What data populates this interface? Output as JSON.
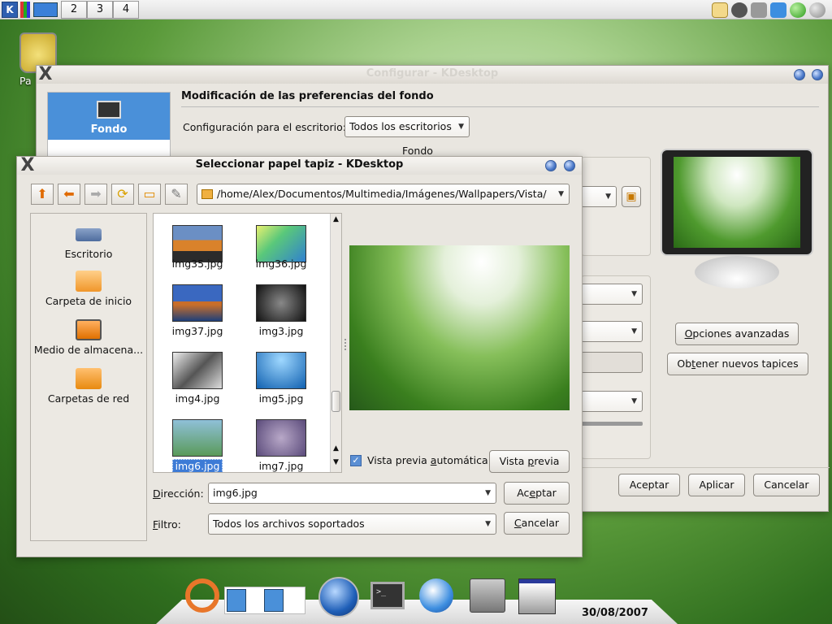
{
  "top_panel": {
    "pagers": [
      "2",
      "3",
      "4"
    ]
  },
  "desktop": {
    "trash_label": "Pa"
  },
  "config": {
    "title": "Configurar - KDesktop",
    "sidebar_active": "Fondo",
    "heading": "Modificación de las preferencias del fondo",
    "desktop_config_label": "Configuración para el escritorio:",
    "desktop_config_value": "Todos los escritorios",
    "group_fondo": "Fondo",
    "advanced_button": "Opciones avanzadas",
    "new_wallpapers_button": "Obtener nuevos tapices",
    "accept": "Aceptar",
    "apply": "Aplicar",
    "cancel": "Cancelar"
  },
  "dialog": {
    "title": "Seleccionar papel tapiz - KDesktop",
    "path": "/home/Alex/Documentos/Multimedia/Imágenes/Wallpapers/Vista/",
    "places": [
      {
        "label": "Escritorio",
        "icon": "desktop-icon"
      },
      {
        "label": "Carpeta de inicio",
        "icon": "home-folder-icon"
      },
      {
        "label": "Medio de almacena...",
        "icon": "storage-media-icon"
      },
      {
        "label": "Carpetas de red",
        "icon": "network-folder-icon"
      }
    ],
    "files": [
      {
        "name": "img35.jpg"
      },
      {
        "name": "img36.jpg"
      },
      {
        "name": "img37.jpg"
      },
      {
        "name": "img3.jpg"
      },
      {
        "name": "img4.jpg"
      },
      {
        "name": "img5.jpg"
      },
      {
        "name": "img6.jpg",
        "selected": true
      },
      {
        "name": "img7.jpg"
      }
    ],
    "auto_preview_label": "Vista previa automática",
    "preview_button": "Vista previa",
    "address_label": "Dirección:",
    "address_value": "img6.jpg",
    "filter_label": "Filtro:",
    "filter_value": "Todos los archivos soportados",
    "accept": "Aceptar",
    "cancel": "Cancelar"
  },
  "taskbar": {
    "date": "30/08/2007"
  },
  "colors": {
    "accent": "#4a90d9",
    "selection": "#3d7bd6"
  }
}
